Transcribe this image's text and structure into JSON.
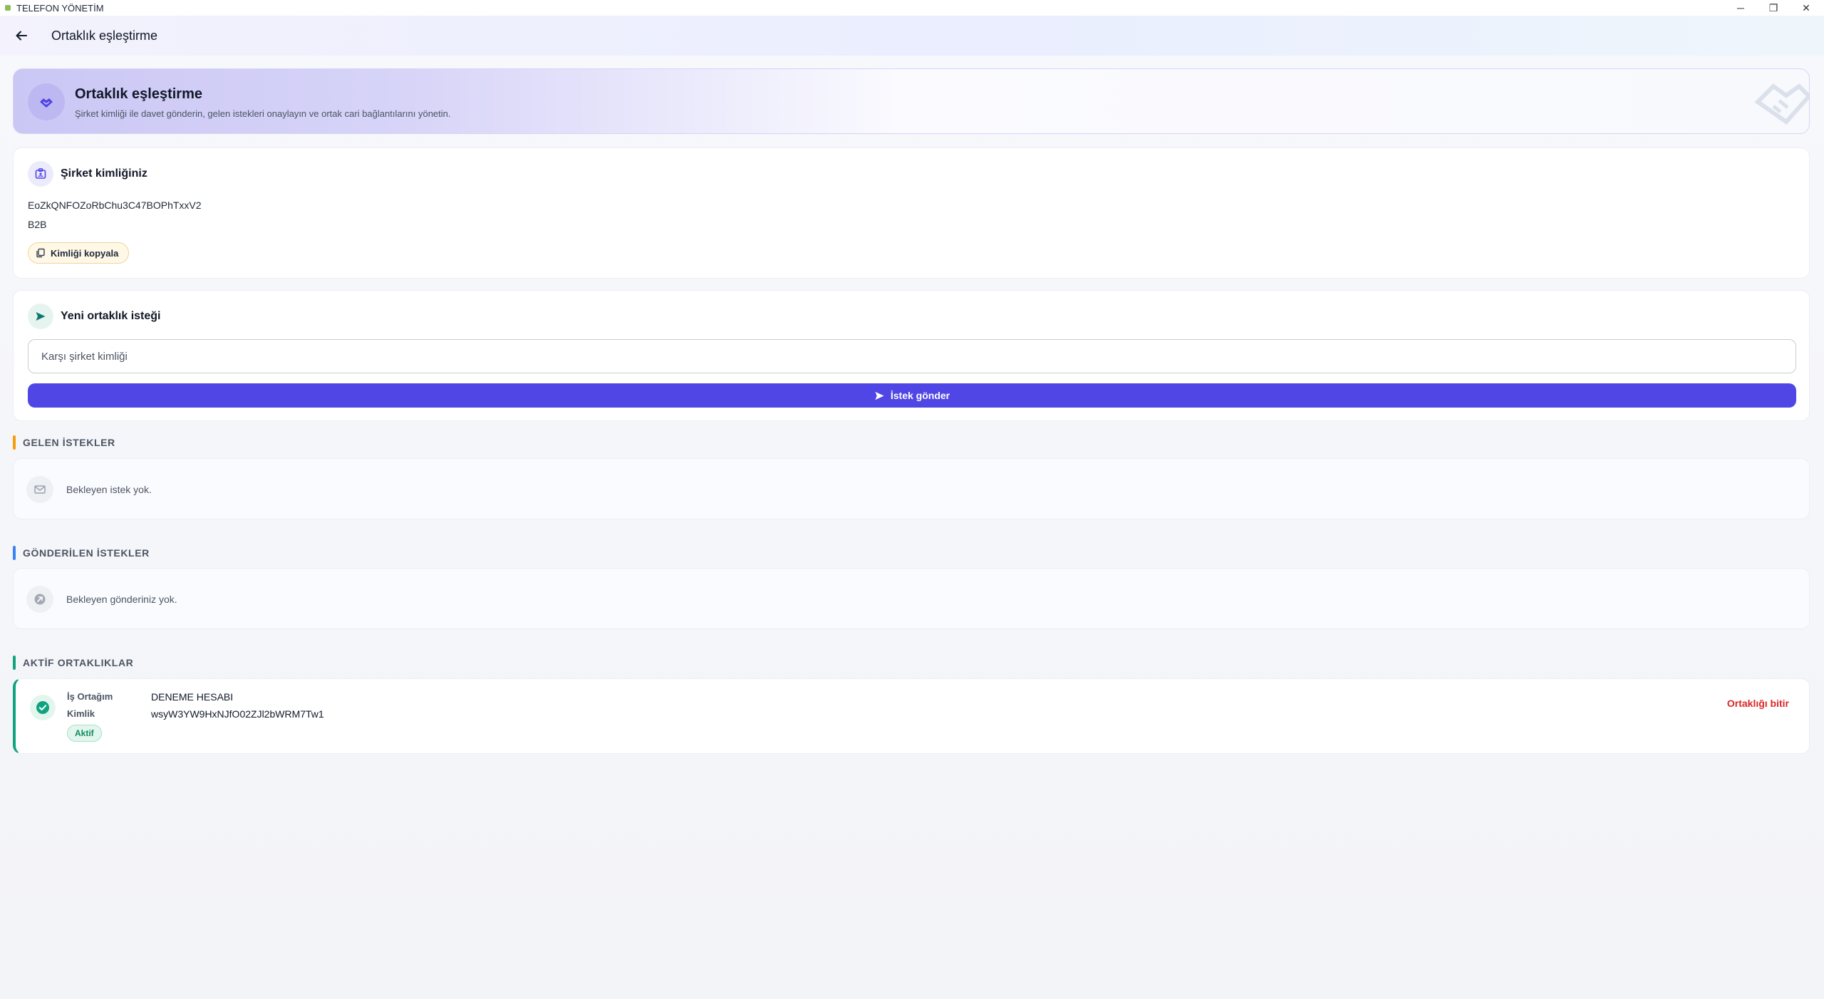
{
  "window": {
    "title": "TELEFON YÖNETİM",
    "controls": {
      "minimize": "─",
      "maximize": "❐",
      "close": "✕"
    }
  },
  "appbar": {
    "title": "Ortaklık eşleştirme"
  },
  "hero": {
    "title": "Ortaklık eşleştirme",
    "subtitle": "Şirket kimliği ile davet gönderin, gelen istekleri onaylayın ve ortak cari bağlantılarını yönetin."
  },
  "company": {
    "title": "Şirket kimliğiniz",
    "id": "EoZkQNFOZoRbChu3C47BOPhTxxV2",
    "type": "B2B",
    "copy_label": "Kimliği kopyala"
  },
  "request": {
    "title": "Yeni ortaklık isteği",
    "input_placeholder": "Karşı şirket kimliği",
    "input_value": "",
    "send_label": "İstek gönder"
  },
  "incoming": {
    "header": "GELEN İSTEKLER",
    "empty_text": "Bekleyen istek yok."
  },
  "sent": {
    "header": "GÖNDERİLEN İSTEKLER",
    "empty_text": "Bekleyen gönderiniz yok."
  },
  "active": {
    "header": "AKTİF ORTAKLIKLAR",
    "items": [
      {
        "partner_label": "İş Ortağım",
        "partner_name": "DENEME HESABI",
        "id_label": "Kimlik",
        "id_value": "wsyW3YW9HxNJfO02ZJl2bWRM7Tw1",
        "status": "Aktif",
        "end_label": "Ortaklığı bitir"
      }
    ]
  },
  "colors": {
    "accent": "#4f46e5",
    "incoming_bar": "#f59e0b",
    "sent_bar": "#3b82f6",
    "active_bar": "#10a37f",
    "danger": "#dc2626"
  }
}
